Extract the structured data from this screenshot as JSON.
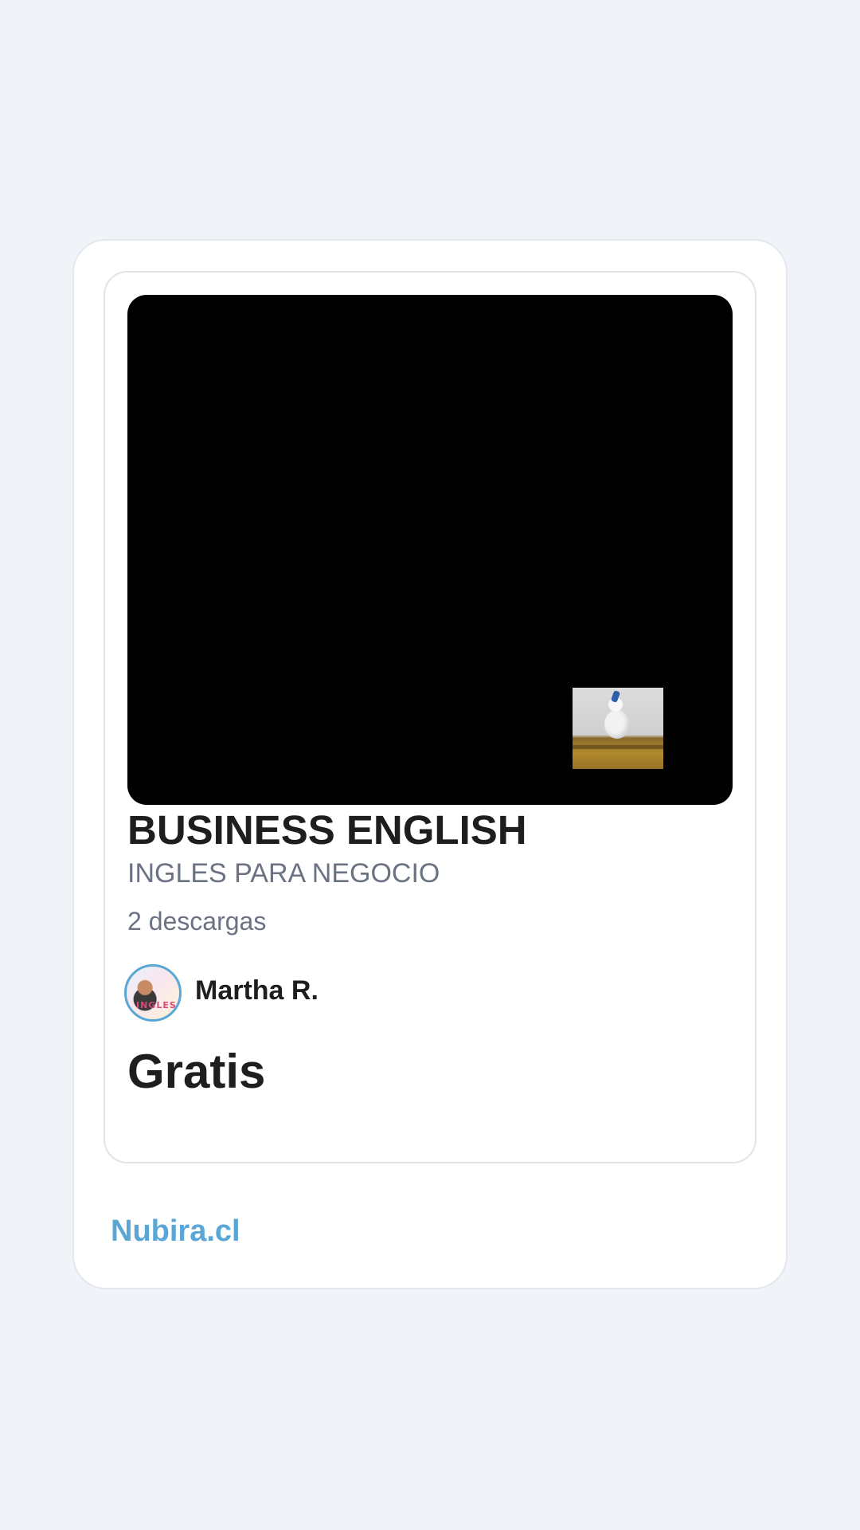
{
  "product": {
    "title": "BUSINESS ENGLISH",
    "subtitle": "INGLES PARA NEGOCIO",
    "downloads": "2 descargas",
    "price": "Gratis"
  },
  "author": {
    "name": "Martha R.",
    "avatar_text": "INGLES"
  },
  "footer": {
    "brand": "Nubira.cl"
  },
  "colors": {
    "page_background": "#f0f4f8",
    "card_background": "#ffffff",
    "preview_background": "#000000",
    "title_text": "#1e1e1e",
    "muted_text": "#6b7383",
    "brand_accent": "#5aa7d6"
  }
}
